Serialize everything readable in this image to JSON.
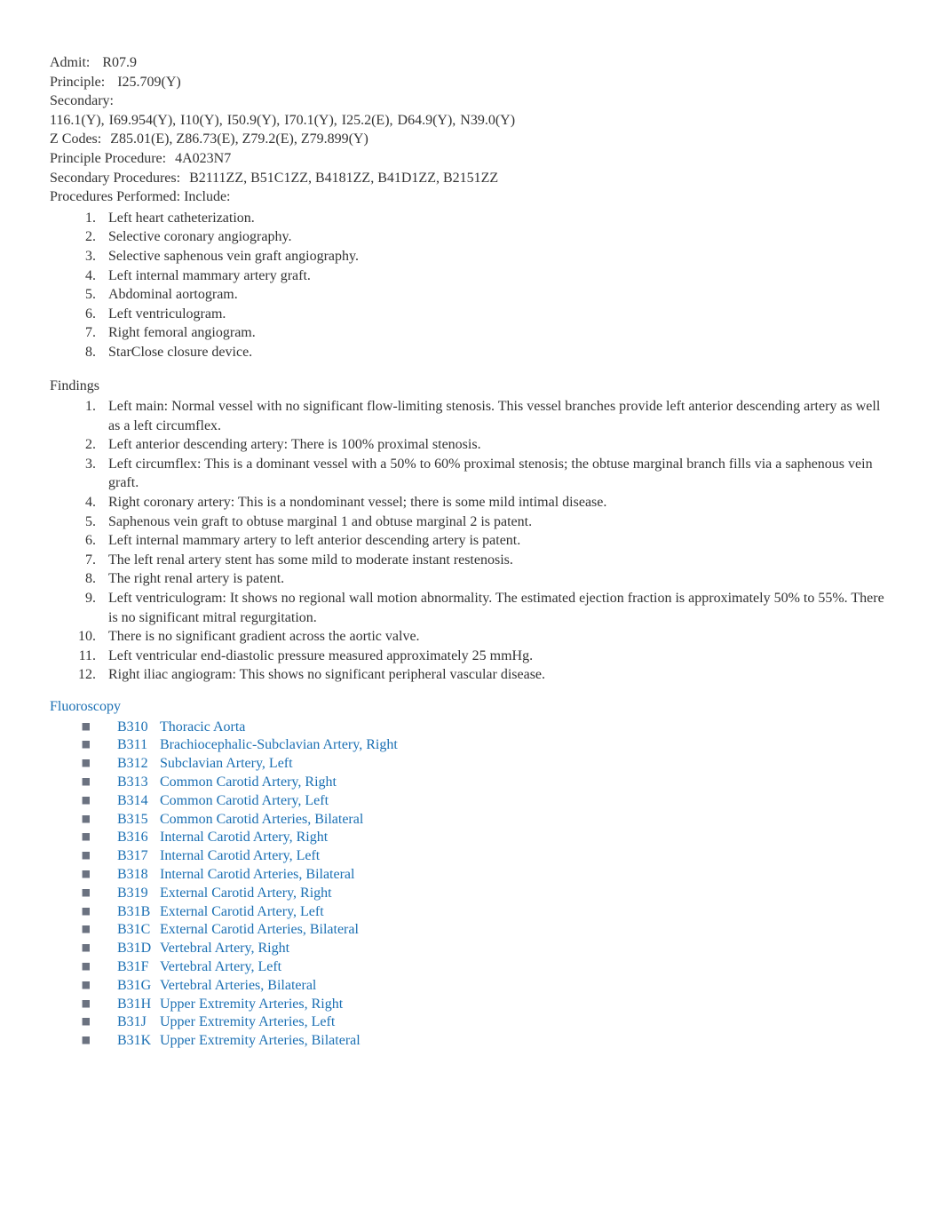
{
  "header": {
    "admit_label": "Admit:",
    "admit_value": "R07.9",
    "principle_label": "Principle:",
    "principle_value": "I25.709(Y)",
    "secondary_label": "Secondary:",
    "secondary_codes": "116.1(Y), I69.954(Y), I10(Y), I50.9(Y), I70.1(Y), I25.2(E), D64.9(Y), N39.0(Y)",
    "zcodes_label": "Z Codes:",
    "zcodes_value": "Z85.01(E), Z86.73(E), Z79.2(E), Z79.899(Y)",
    "principle_proc_label": "Principle Procedure:",
    "principle_proc_value": "4A023N7",
    "secondary_proc_label": "Secondary Procedures:",
    "secondary_proc_value": "B2111ZZ, B51C1ZZ, B4181ZZ, B41D1ZZ, B2151ZZ",
    "procedures_performed_label": "Procedures Performed: Include:"
  },
  "procedures": [
    "Left heart catheterization.",
    "Selective coronary angiography.",
    "Selective saphenous vein graft angiography.",
    "Left internal mammary artery graft.",
    "Abdominal aortogram.",
    "Left ventriculogram.",
    "Right femoral angiogram.",
    "StarClose closure device."
  ],
  "findings_label": "Findings",
  "findings": [
    "Left main: Normal vessel with no significant flow-limiting stenosis. This vessel branches provide left anterior descending artery as well as a left circumflex.",
    "Left anterior descending artery: There is 100% proximal stenosis.",
    "Left circumflex: This is a dominant vessel with a 50% to 60% proximal stenosis; the obtuse marginal branch fills via a saphenous vein graft.",
    "Right coronary artery: This is a nondominant vessel; there is some mild intimal disease.",
    "Saphenous vein graft to obtuse marginal 1 and obtuse marginal 2 is patent.",
    "Left internal mammary artery to left anterior descending artery is patent.",
    "The left renal artery stent has some mild to moderate instant restenosis.",
    "The right renal artery is patent.",
    "Left ventriculogram: It shows no regional wall motion abnormality. The estimated ejection fraction is approximately 50% to 55%. There is no significant mitral regurgitation.",
    "There is no significant gradient across the aortic valve.",
    "Left ventricular end-diastolic pressure measured approximately 25 mmHg.",
    "Right iliac angiogram: This shows no significant peripheral vascular disease."
  ],
  "fluoroscopy_label": "Fluoroscopy",
  "fluoroscopy": [
    {
      "code": "B310",
      "desc": "Thoracic Aorta"
    },
    {
      "code": "B311",
      "desc": "Brachiocephalic-Subclavian Artery, Right"
    },
    {
      "code": "B312",
      "desc": "Subclavian Artery, Left"
    },
    {
      "code": "B313",
      "desc": "Common Carotid Artery, Right"
    },
    {
      "code": "B314",
      "desc": "Common Carotid Artery, Left"
    },
    {
      "code": "B315",
      "desc": "Common Carotid Arteries, Bilateral"
    },
    {
      "code": "B316",
      "desc": "Internal Carotid Artery, Right"
    },
    {
      "code": "B317",
      "desc": "Internal Carotid Artery, Left"
    },
    {
      "code": "B318",
      "desc": "Internal Carotid Arteries, Bilateral"
    },
    {
      "code": "B319",
      "desc": "External Carotid Artery, Right"
    },
    {
      "code": "B31B",
      "desc": "External Carotid Artery, Left"
    },
    {
      "code": "B31C",
      "desc": "External Carotid Arteries, Bilateral"
    },
    {
      "code": "B31D",
      "desc": "Vertebral Artery, Right"
    },
    {
      "code": "B31F",
      "desc": "Vertebral Artery, Left"
    },
    {
      "code": "B31G",
      "desc": "Vertebral Arteries, Bilateral"
    },
    {
      "code": "B31H",
      "desc": "Upper Extremity Arteries, Right"
    },
    {
      "code": "B31J",
      "desc": "Upper Extremity Arteries, Left"
    },
    {
      "code": "B31K",
      "desc": "Upper Extremity Arteries, Bilateral"
    }
  ],
  "bullet_glyph": "⯀"
}
